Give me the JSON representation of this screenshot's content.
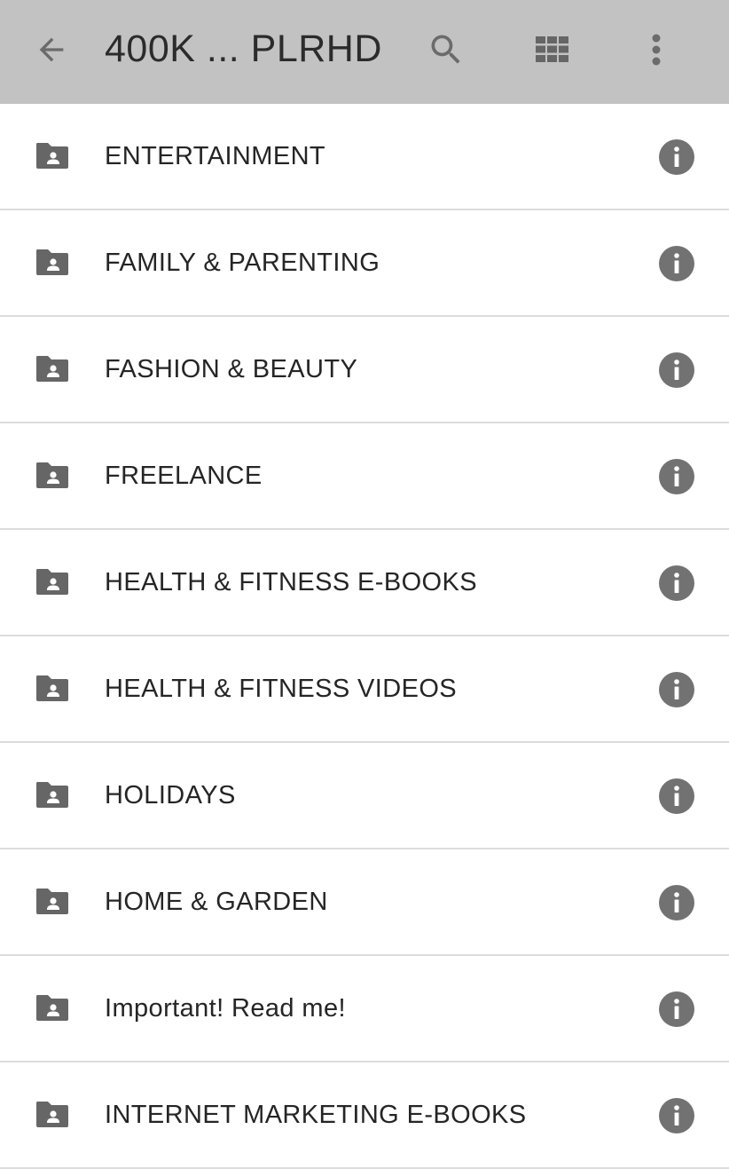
{
  "header": {
    "title": "400K ... PLRHD",
    "icons": {
      "back": "arrow-left-icon",
      "search": "search-icon",
      "grid": "grid-view-icon",
      "more": "more-vert-icon"
    },
    "background_color": "#c2c2c2"
  },
  "list": {
    "item_icon": "shared-folder-icon",
    "action_icon": "info-icon",
    "items": [
      {
        "label": "ENTERTAINMENT"
      },
      {
        "label": "FAMILY & PARENTING"
      },
      {
        "label": "FASHION & BEAUTY"
      },
      {
        "label": "FREELANCE"
      },
      {
        "label": "HEALTH & FITNESS E-BOOKS"
      },
      {
        "label": "HEALTH & FITNESS VIDEOS"
      },
      {
        "label": "HOLIDAYS"
      },
      {
        "label": "HOME & GARDEN"
      },
      {
        "label": "Important! Read me!"
      },
      {
        "label": "INTERNET MARKETING E-BOOKS"
      }
    ]
  },
  "colors": {
    "icon_gray": "#666666",
    "text_dark": "#252525",
    "divider": "#dcdcdc"
  }
}
